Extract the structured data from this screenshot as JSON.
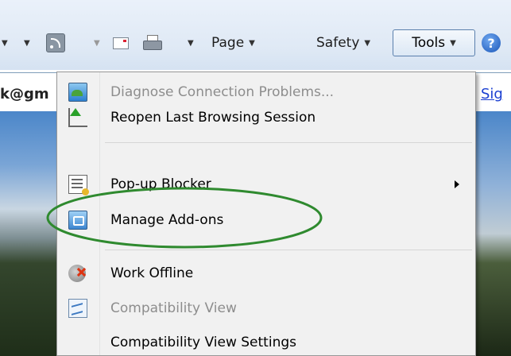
{
  "toolbar": {
    "page_label": "Page",
    "safety_label": "Safety",
    "tools_label": "Tools",
    "help_glyph": "?",
    "icons": [
      "feed-icon",
      "read-mail-icon",
      "print-icon",
      "help-icon"
    ]
  },
  "page": {
    "email_fragment": "k@gm",
    "sign_in_fragment": "Sig"
  },
  "menu": {
    "items": [
      {
        "label": "Diagnose Connection Problems...",
        "icon": "diagnose-icon",
        "enabled": false
      },
      {
        "label": "Reopen Last Browsing Session",
        "icon": "reopen-session-icon",
        "enabled": true
      },
      {
        "label": "Pop-up Blocker",
        "icon": "popup-blocker-icon",
        "enabled": true,
        "submenu": true
      },
      {
        "label": "Manage Add-ons",
        "icon": "manage-addons-icon",
        "enabled": true,
        "highlighted_by_annotation": true
      },
      {
        "label": "Work Offline",
        "icon": "work-offline-icon",
        "enabled": true
      },
      {
        "label": "Compatibility View",
        "icon": "compatibility-view-icon",
        "enabled": false
      },
      {
        "label": "Compatibility View Settings",
        "icon": "",
        "enabled": true
      }
    ]
  },
  "colors": {
    "annotation_ellipse": "#2f8a2f",
    "link": "#1a3fd1",
    "tools_button_border": "#5b80ad"
  }
}
